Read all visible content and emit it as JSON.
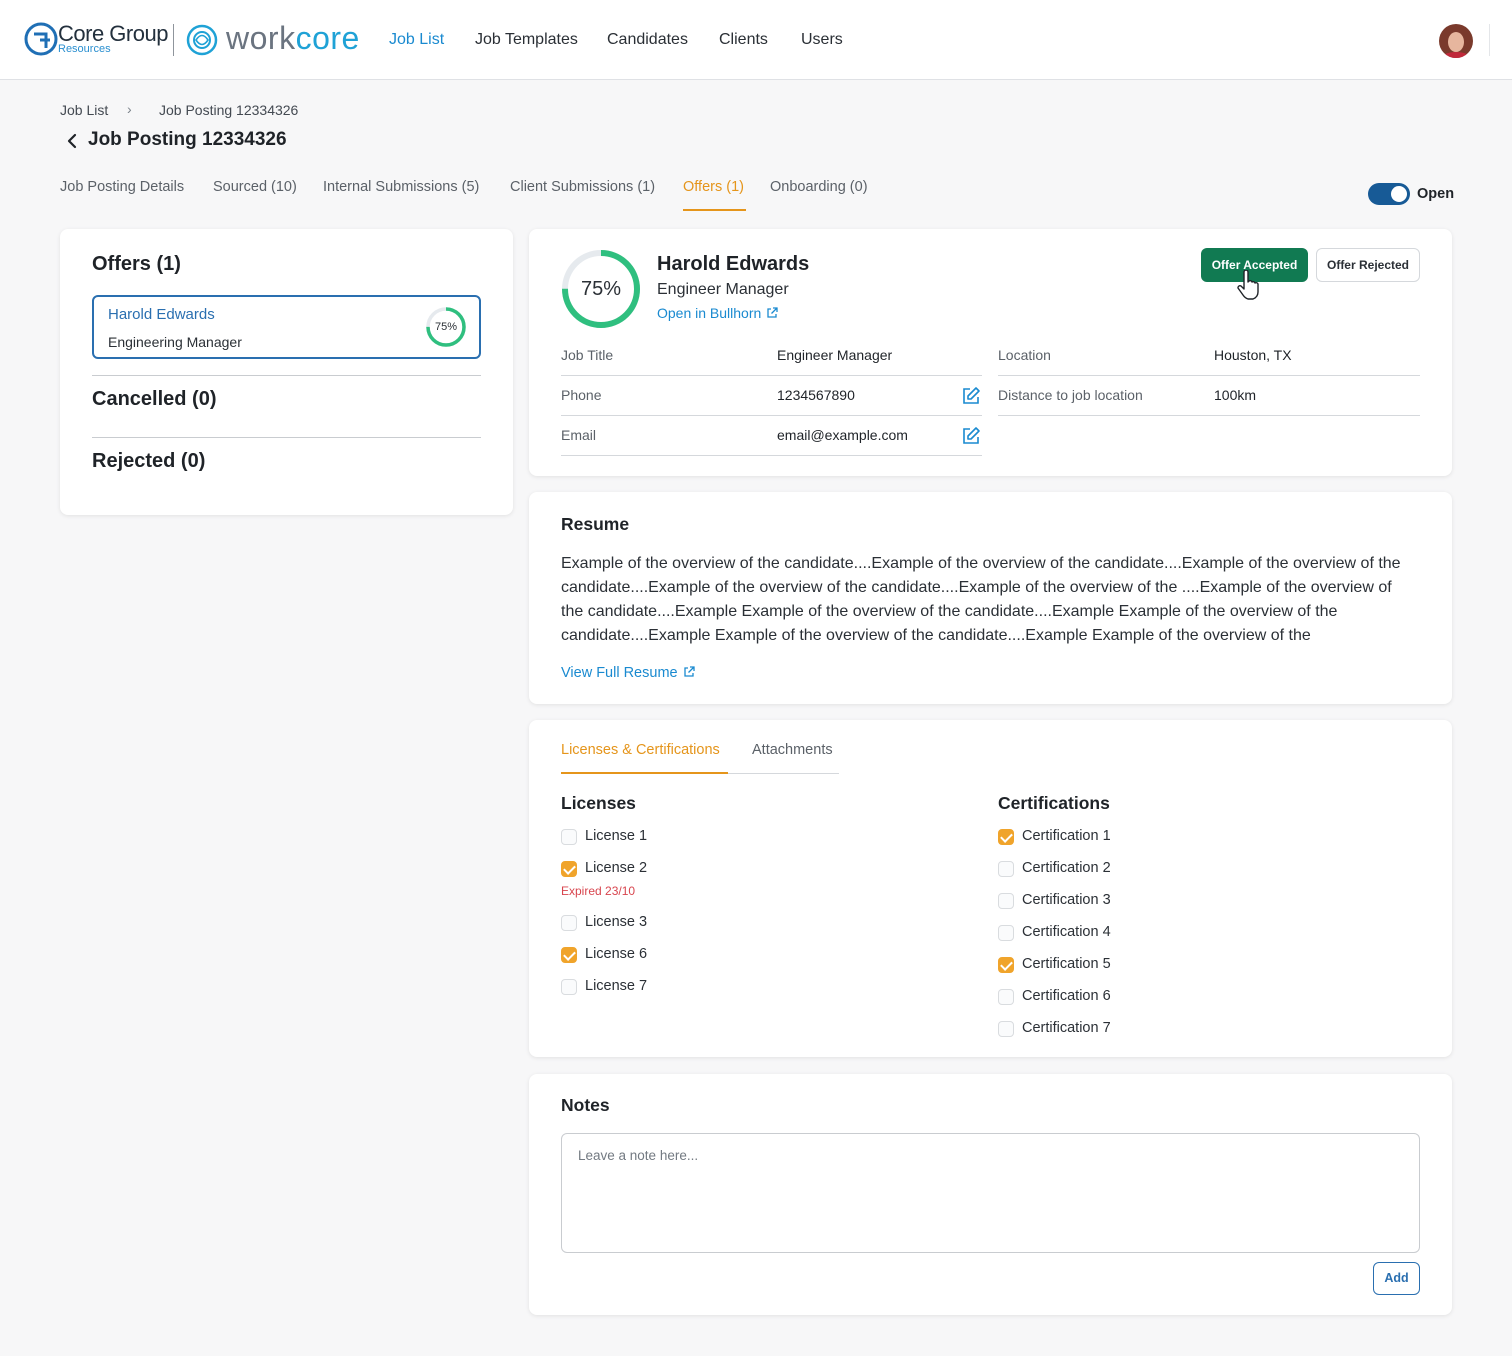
{
  "brand": {
    "core_group": "Core Group",
    "core_group_sub": "Resources",
    "workcore_prefix": "work",
    "workcore_suffix": "core",
    "accent": "#1a8ad0"
  },
  "nav": {
    "items": [
      {
        "label": "Job List",
        "active": true
      },
      {
        "label": "Job Templates"
      },
      {
        "label": "Candidates"
      },
      {
        "label": "Clients"
      },
      {
        "label": "Users"
      }
    ]
  },
  "breadcrumb": [
    "Job List",
    "Job Posting 12334326"
  ],
  "page_title": "Job Posting 12334326",
  "tabs": [
    {
      "label": "Job Posting Details"
    },
    {
      "label": "Sourced (10)"
    },
    {
      "label": "Internal Submissions (5)"
    },
    {
      "label": "Client Submissions (1)"
    },
    {
      "label": "Offers (1)",
      "active": true
    },
    {
      "label": "Onboarding (0)"
    }
  ],
  "status_toggle": {
    "label": "Open",
    "on": true
  },
  "offers_panel": {
    "offers_title": "Offers (1)",
    "offer": {
      "name": "Harold Edwards",
      "role": "Engineering Manager",
      "match": "75%",
      "match_value": 0.75
    },
    "cancelled_title": "Cancelled (0)",
    "rejected_title": "Rejected (0)"
  },
  "candidate": {
    "match": "75%",
    "match_value": 0.75,
    "name": "Harold Edwards",
    "role": "Engineer Manager",
    "bullhorn_link": "Open in Bullhorn",
    "accept_button": "Offer Accepted",
    "reject_button": "Offer Rejected",
    "fields": {
      "job_title_label": "Job Title",
      "job_title": "Engineer Manager",
      "phone_label": "Phone",
      "phone": "1234567890",
      "email_label": "Email",
      "email": "email@example.com",
      "location_label": "Location",
      "location": "Houston, TX",
      "distance_label": "Distance to job location",
      "distance": "100km"
    }
  },
  "resume": {
    "title": "Resume",
    "text": "Example of the overview of the candidate....Example of the overview of the candidate....Example of the overview of the candidate....Example of the overview of the candidate....Example of the overview of the ....Example of the overview of the candidate....Example Example of the overview of the candidate....Example Example of the overview of the candidate....Example Example of the overview of the candidate....Example Example of the overview of the",
    "link": "View Full Resume"
  },
  "qualifications": {
    "tabs": [
      {
        "label": "Licenses & Certifications",
        "active": true
      },
      {
        "label": "Attachments"
      }
    ],
    "licenses_title": "Licenses",
    "licenses": [
      {
        "label": "License 1",
        "checked": false
      },
      {
        "label": "License 2",
        "checked": true,
        "note": "Expired 23/10"
      },
      {
        "label": "License 3",
        "checked": false
      },
      {
        "label": "License 6",
        "checked": true
      },
      {
        "label": "License 7",
        "checked": false
      }
    ],
    "certifications_title": "Certifications",
    "certifications": [
      {
        "label": "Certification 1",
        "checked": true
      },
      {
        "label": "Certification 2",
        "checked": false
      },
      {
        "label": "Certification 3",
        "checked": false
      },
      {
        "label": "Certification 4",
        "checked": false
      },
      {
        "label": "Certification 5",
        "checked": true
      },
      {
        "label": "Certification 6",
        "checked": false
      },
      {
        "label": "Certification 7",
        "checked": false
      }
    ]
  },
  "notes": {
    "title": "Notes",
    "placeholder": "Leave a note here...",
    "add_button": "Add"
  }
}
